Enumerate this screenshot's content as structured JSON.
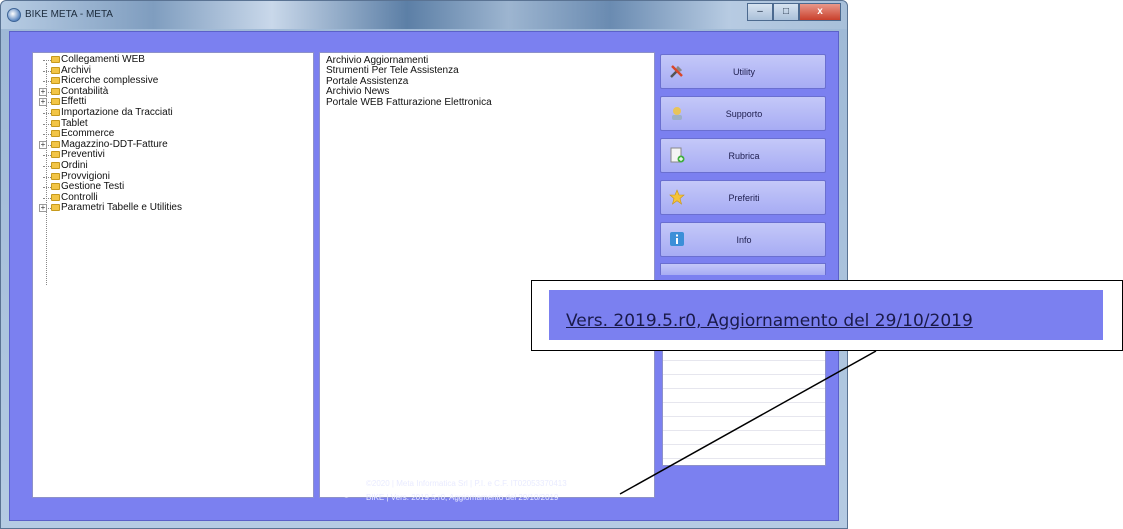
{
  "window": {
    "title": "BIKE META - META",
    "buttons": [
      "–",
      "□",
      "x"
    ]
  },
  "tree": {
    "items": [
      {
        "label": "Collegamenti WEB",
        "expandable": false
      },
      {
        "label": "Archivi",
        "expandable": false
      },
      {
        "label": "Ricerche complessive",
        "expandable": false
      },
      {
        "label": "Contabilità",
        "expandable": true
      },
      {
        "label": "Effetti",
        "expandable": true
      },
      {
        "label": "Importazione da Tracciati",
        "expandable": false
      },
      {
        "label": "Tablet",
        "expandable": false
      },
      {
        "label": "Ecommerce",
        "expandable": false
      },
      {
        "label": "Magazzino-DDT-Fatture",
        "expandable": true
      },
      {
        "label": "Preventivi",
        "expandable": false
      },
      {
        "label": "Ordini",
        "expandable": false
      },
      {
        "label": "Provvigioni",
        "expandable": false
      },
      {
        "label": "Gestione Testi",
        "expandable": false
      },
      {
        "label": "Controlli",
        "expandable": false
      },
      {
        "label": "Parametri Tabelle e Utilities",
        "expandable": true
      }
    ]
  },
  "links": {
    "items": [
      "Archivio Aggiornamenti",
      "Strumenti Per Tele Assistenza",
      "Portale Assistenza",
      "Archivio News",
      "Portale WEB Fatturazione Elettronica"
    ]
  },
  "side_buttons": [
    {
      "label": "Utility",
      "icon": "tools-icon"
    },
    {
      "label": "Supporto",
      "icon": "support-icon"
    },
    {
      "label": "Rubrica",
      "icon": "address-book-icon"
    },
    {
      "label": "Preferiti",
      "icon": "star-icon"
    },
    {
      "label": "Info",
      "icon": "info-icon"
    }
  ],
  "footer": {
    "line1": "©2020 | Meta Informatica Srl | P.I. e C.F. IT02053370413",
    "line2": "BIKE | Vers. 2019.5.r0, Aggiornamento  del 29/10/2019"
  },
  "callout": {
    "text": "Vers. 2019.5.r0, Aggiornamento  del 29/10/2019"
  },
  "colors": {
    "client_bg": "#7b80f0",
    "button_bg": "#b4b8f6",
    "folder": "#f2c547"
  }
}
